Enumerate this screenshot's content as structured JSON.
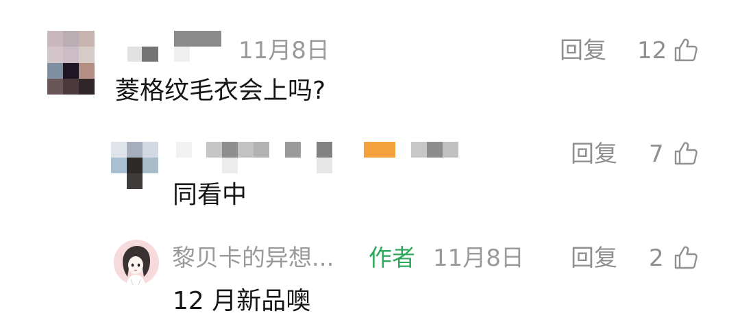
{
  "comments": [
    {
      "date": "11月8日",
      "reply_label": "回复",
      "like_count": "12",
      "content": "菱格纹毛衣会上吗?"
    },
    {
      "reply_label": "回复",
      "like_count": "7",
      "content": "同看中"
    },
    {
      "username": "黎贝卡的异想...",
      "author_badge": "作者",
      "date": "11月8日",
      "reply_label": "回复",
      "like_count": "2",
      "content": "12 月新品噢"
    }
  ],
  "icons": {
    "like": "thumbs-up-icon"
  },
  "colors": {
    "author_badge": "#2eaa5c",
    "meta_text": "#9a9a9a"
  }
}
